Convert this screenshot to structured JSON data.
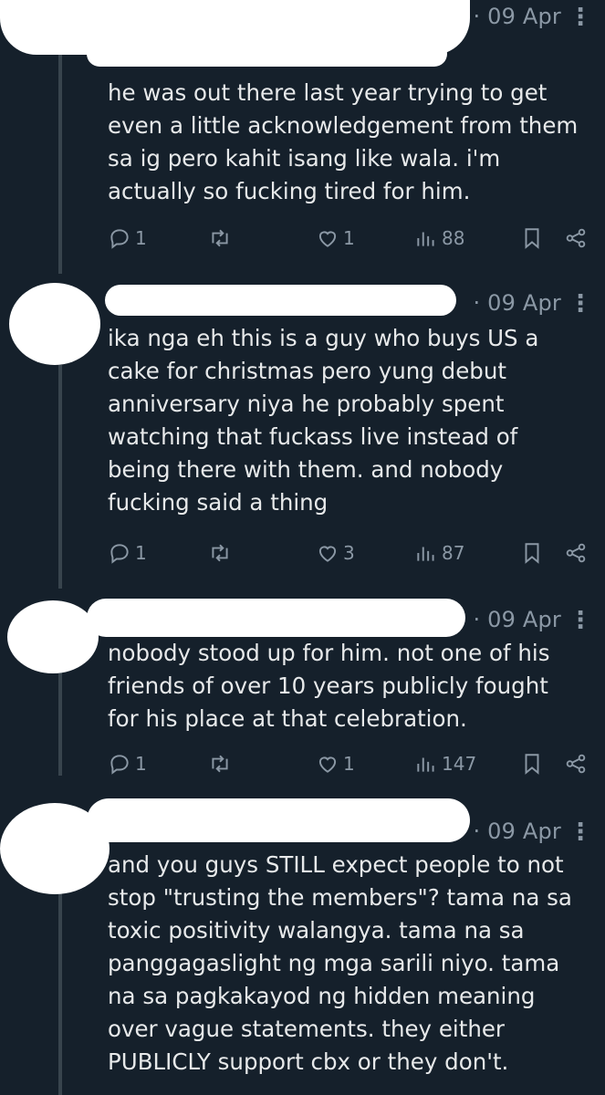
{
  "tweets": [
    {
      "time": "· 09 Apr",
      "more": "⋮",
      "text": "he was out there last year trying to get\neven a little acknowledgement from them\nsa ig pero kahit isang like wala. i'm\nactually so fucking tired for him.",
      "replies": "1",
      "retweets": "",
      "likes": "1",
      "views": "88"
    },
    {
      "time": "· 09 Apr",
      "more": "⋮",
      "text": "ika nga eh this is a guy who buys US a\ncake for christmas pero yung debut\nanniversary niya he probably spent\nwatching that fuckass live instead of\nbeing there with them. and nobody\nfucking said a thing",
      "replies": "1",
      "retweets": "",
      "likes": "3",
      "views": "87"
    },
    {
      "time": "· 09 Apr",
      "more": "⋮",
      "text": "nobody stood up for him. not one of his\nfriends of over 10 years publicly fought\nfor his place at that celebration.",
      "replies": "1",
      "retweets": "",
      "likes": "1",
      "views": "147"
    },
    {
      "time": "· 09 Apr",
      "more": "⋮",
      "text": "and you guys STILL expect people to not\nstop \"trusting the members\"? tama na sa\ntoxic positivity walangya. tama na sa\npanggagaslight ng mga sarili niyo. tama\nna sa pagkakayod ng hidden meaning\nover vague statements. they either\nPUBLICLY support cbx or they don't.",
      "replies": "",
      "retweets": "",
      "likes": "",
      "views": ""
    }
  ],
  "icons": {
    "reply": "reply-icon",
    "retweet": "retweet-icon",
    "like": "heart-icon",
    "views": "views-icon",
    "bookmark": "bookmark-icon",
    "share": "share-icon"
  },
  "colors": {
    "background": "#15202b",
    "text": "#e7e9ea",
    "muted": "#8b98a5",
    "thread_line": "#38444d"
  }
}
